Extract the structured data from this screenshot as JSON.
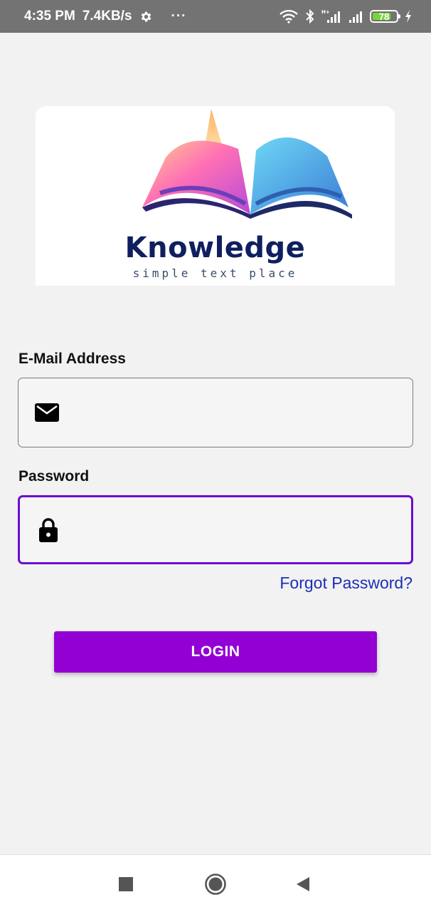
{
  "status_bar": {
    "time": "4:35 PM",
    "network_speed": "7.4KB/s",
    "more_indicator": "···",
    "battery_level": "78",
    "battery_fraction": 0.78,
    "icons": [
      "gear-icon",
      "wifi-icon",
      "bluetooth-icon",
      "signal-icon",
      "battery-icon",
      "charging-icon"
    ]
  },
  "logo": {
    "title": "Knowledge",
    "subtitle": "simple text place"
  },
  "form": {
    "email_label": "E-Mail Address",
    "email_value": "",
    "email_icon": "mail-icon",
    "password_label": "Password",
    "password_value": "",
    "password_icon": "lock-icon",
    "forgot_link": "Forgot Password?",
    "login_button": "LOGIN"
  },
  "nav_bar": {
    "icons": [
      "recent-apps-icon",
      "home-icon",
      "back-icon"
    ]
  },
  "colors": {
    "accent": "#9200d4",
    "focus_border": "#6a0dd1",
    "link": "#1c2fb5",
    "status_bar": "#737373",
    "battery_fill": "#77d63a"
  }
}
